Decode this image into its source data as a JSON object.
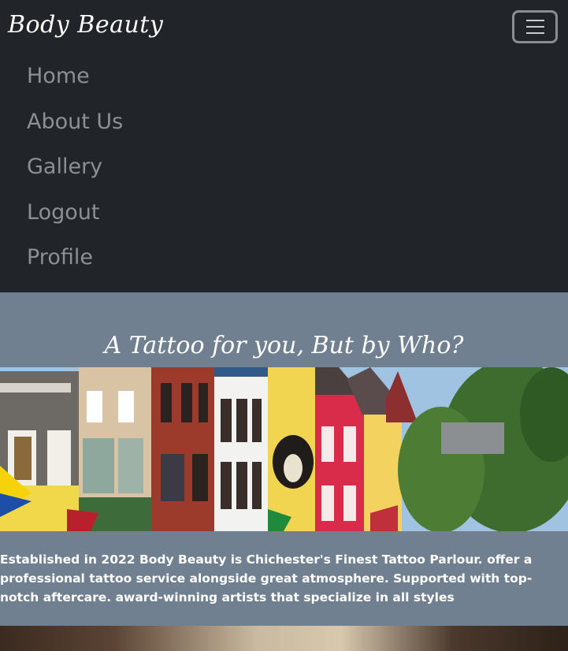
{
  "navbar": {
    "brand": "Body Beauty",
    "items": [
      {
        "label": "Home"
      },
      {
        "label": "About Us"
      },
      {
        "label": "Gallery"
      },
      {
        "label": "Logout"
      },
      {
        "label": "Profile"
      }
    ]
  },
  "hero": {
    "title": "A Tattoo for you, But by Who?",
    "intro": "Established in 2022 Body Beauty is Chichester's Finest Tattoo Parlour. offer a professional tattoo service alongside great atmosphere. Supported with top-notch aftercare. award-winning artists that specialize in all styles"
  },
  "colors": {
    "navbar_bg": "#212529",
    "hero_bg": "#708090",
    "nav_link": "#8c8f93"
  }
}
